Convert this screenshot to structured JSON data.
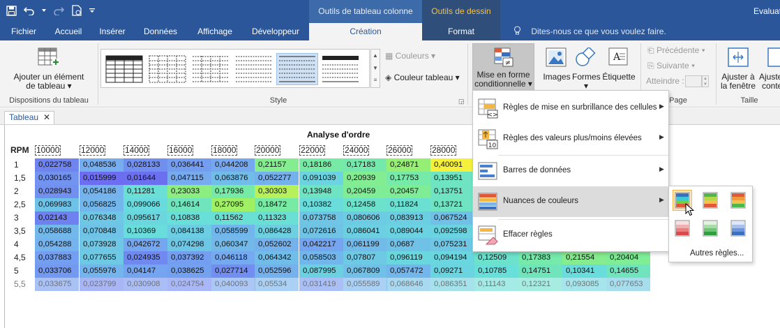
{
  "titlebar": {
    "ctx_tab_1": "Outils de tableau colonne",
    "ctx_tab_2": "Outils de dessin",
    "app_title": "Evaluat",
    "accent": "#2b579a"
  },
  "tabs": {
    "fichier": "Fichier",
    "accueil": "Accueil",
    "inserer": "Insérer",
    "donnees": "Données",
    "affichage": "Affichage",
    "developpeur": "Développeur",
    "creation": "Création",
    "format": "Format",
    "tellme": "Dites-nous ce que vous voulez faire."
  },
  "ribbon": {
    "add_element_line1": "Ajouter un élément",
    "add_element_line2": "de tableau",
    "group_dispositions": "Dispositions du tableau",
    "group_style": "Style",
    "couleurs": "Couleurs",
    "couleur_tableau": "Couleur tableau",
    "mef_line1": "Mise en forme",
    "mef_line2": "conditionnelle",
    "images": "Images",
    "formes": "Formes",
    "etiquette": "Étiquette",
    "precedente": "Précédente",
    "suivante": "Suivante",
    "atteindre": "Atteindre :",
    "group_page": "Page",
    "ajuster_line1": "Ajuster à",
    "ajuster_line2": "la fenêtre",
    "ajuster2_line1": "Ajuste",
    "ajuster2_line2": "conte",
    "group_taille": "Taille"
  },
  "document": {
    "tab_name": "Tableau",
    "title": "Analyse d'ordre",
    "row_header": "RPM",
    "columns": [
      "10000",
      "12000",
      "14000",
      "16000",
      "18000",
      "20000",
      "22000",
      "24000",
      "26000",
      "28000"
    ],
    "rows": [
      {
        "label": "1",
        "values": [
          "0,022758",
          "0,048536",
          "0,028133",
          "0,036441",
          "0,044208",
          "0,21157",
          "0,18186",
          "0,17183",
          "0,24871",
          "0,40091"
        ]
      },
      {
        "label": "1,5",
        "values": [
          "0,030165",
          "0,015999",
          "0,01644",
          "0,047115",
          "0,063876",
          "0,052277",
          "0,091039",
          "0,20939",
          "0,17753",
          "0,13951"
        ]
      },
      {
        "label": "2",
        "values": [
          "0,028943",
          "0,054186",
          "0,11281",
          "0,23033",
          "0,17936",
          "0,30303",
          "0,13948",
          "0,20459",
          "0,20457",
          "0,13751"
        ]
      },
      {
        "label": "2,5",
        "values": [
          "0,069983",
          "0,056825",
          "0,099066",
          "0,14614",
          "0,27095",
          "0,18472",
          "0,10382",
          "0,12458",
          "0,11824",
          "0,13721"
        ]
      },
      {
        "label": "3",
        "values": [
          "0,02143",
          "0,076348",
          "0,095617",
          "0,10838",
          "0,11562",
          "0,11323",
          "0,073758",
          "0,080606",
          "0,083913",
          "0,067524"
        ]
      },
      {
        "label": "3,5",
        "values": [
          "0,058688",
          "0,070848",
          "0,10369",
          "0,084138",
          "0,058599",
          "0,086428",
          "0,072616",
          "0,086041",
          "0,089044",
          "0,092598"
        ]
      },
      {
        "label": "4",
        "values": [
          "0,054288",
          "0,073928",
          "0,042672",
          "0,074298",
          "0,060347",
          "0,052602",
          "0,042217",
          "0,061199",
          "0,0687",
          "0,075231"
        ]
      },
      {
        "label": "4,5",
        "values": [
          "0,037883",
          "0,077655",
          "0,024935",
          "0,037392",
          "0,046118",
          "0,064342",
          "0,058503",
          "0,07807",
          "0,096119",
          "0,094194",
          "0,12509",
          "0,17383",
          "0,21554",
          "0,20404"
        ]
      },
      {
        "label": "5",
        "values": [
          "0,033706",
          "0,055976",
          "0,04147",
          "0,038625",
          "0,027714",
          "0,052596",
          "0,087995",
          "0,067809",
          "0,057472",
          "0,09271",
          "0,10785",
          "0,14751",
          "0,10341",
          "0,14655"
        ]
      },
      {
        "label": "5,5",
        "values": [
          "0,033675",
          "0,023799",
          "0,030908",
          "0,024754",
          "0,040093",
          "0,05534",
          "0,031419",
          "0,055589",
          "0,068646",
          "0,086351",
          "0,11143",
          "0,12321",
          "0,093085",
          "0,077653"
        ]
      }
    ]
  },
  "menu": {
    "items": [
      {
        "label": "Règles de mise en surbrillance des cellules",
        "icon": "highlight-rules-icon"
      },
      {
        "label": "Règles des valeurs plus/moins élevées",
        "icon": "top-bottom-rules-icon"
      },
      {
        "label": "Barres de données",
        "icon": "data-bars-icon"
      },
      {
        "label": "Nuances de couleurs",
        "icon": "color-scales-icon"
      },
      {
        "label": "Effacer règles",
        "icon": "clear-rules-icon"
      }
    ],
    "submenu_more": "Autres règles..."
  }
}
